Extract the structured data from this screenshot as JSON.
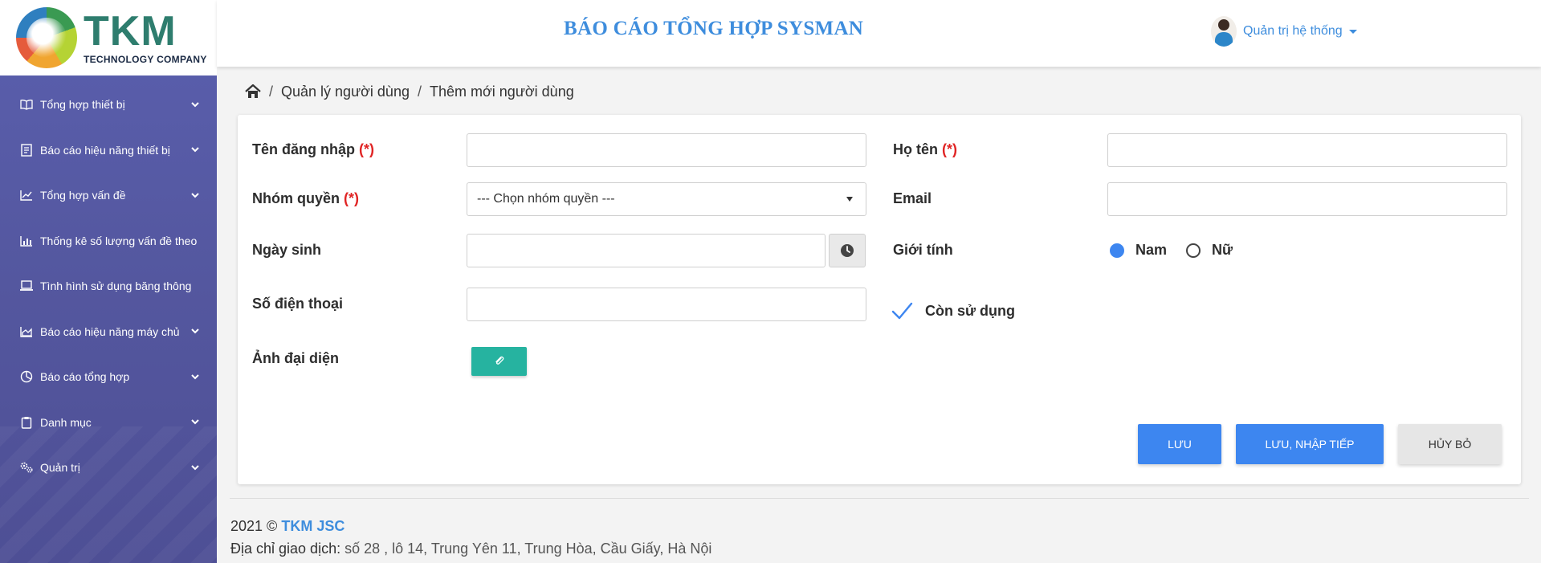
{
  "logo": {
    "main": "TKM",
    "sub": "TECHNOLOGY COMPANY"
  },
  "sidebar": {
    "items": [
      {
        "label": "Tổng hợp thiết bị",
        "icon": "book-open-icon",
        "has_children": true
      },
      {
        "label": "Báo cáo hiệu năng thiết bị",
        "icon": "report-icon",
        "has_children": true
      },
      {
        "label": "Tổng hợp vấn đề",
        "icon": "line-chart-icon",
        "has_children": true
      },
      {
        "label": "Thống kê số lượng vấn đề theo",
        "icon": "bar-chart-icon",
        "has_children": false
      },
      {
        "label": "Tình hình sử dụng băng thông",
        "icon": "laptop-icon",
        "has_children": false
      },
      {
        "label": "Báo cáo hiệu năng máy chủ",
        "icon": "area-chart-icon",
        "has_children": true
      },
      {
        "label": "Báo cáo tổng hợp",
        "icon": "pie-chart-icon",
        "has_children": true
      },
      {
        "label": "Danh mục",
        "icon": "clipboard-icon",
        "has_children": true
      },
      {
        "label": "Quản trị",
        "icon": "cogs-icon",
        "has_children": true
      }
    ]
  },
  "header": {
    "title": "BÁO CÁO TỔNG HỢP SYSMAN",
    "user_name": "Quản trị hệ thống"
  },
  "breadcrumb": {
    "parent": "Quản lý người dùng",
    "current": "Thêm mới người dùng"
  },
  "form": {
    "required_mark": "(*)",
    "username": {
      "label": "Tên đăng nhập",
      "value": ""
    },
    "fullname": {
      "label": "Họ tên",
      "value": ""
    },
    "role": {
      "label": "Nhóm quyền",
      "selected": "--- Chọn nhóm quyền ---"
    },
    "email": {
      "label": "Email",
      "value": ""
    },
    "birthday": {
      "label": "Ngày sinh",
      "value": ""
    },
    "gender": {
      "label": "Giới tính",
      "options": [
        "Nam",
        "Nữ"
      ],
      "selected": "Nam"
    },
    "phone": {
      "label": "Số điện thoại",
      "value": ""
    },
    "active": {
      "label": "Còn sử dụng",
      "checked": true
    },
    "avatar": {
      "label": "Ảnh đại diện"
    }
  },
  "actions": {
    "save": "LƯU",
    "save_continue": "LƯU, NHẬP TIẾP",
    "cancel": "HỦY BỎ"
  },
  "footer": {
    "copyright": "2021 ©",
    "company": "TKM JSC",
    "address_label": "Địa chỉ giao dịch:",
    "address": "số 28 , lô 14, Trung Yên 11, Trung Hòa, Cầu Giấy, Hà Nội"
  },
  "colors": {
    "accent": "#3d86f0",
    "sidebar": "#5a5fae",
    "title": "#3e8ddd",
    "upload": "#26b3a0",
    "required": "#e02424"
  }
}
